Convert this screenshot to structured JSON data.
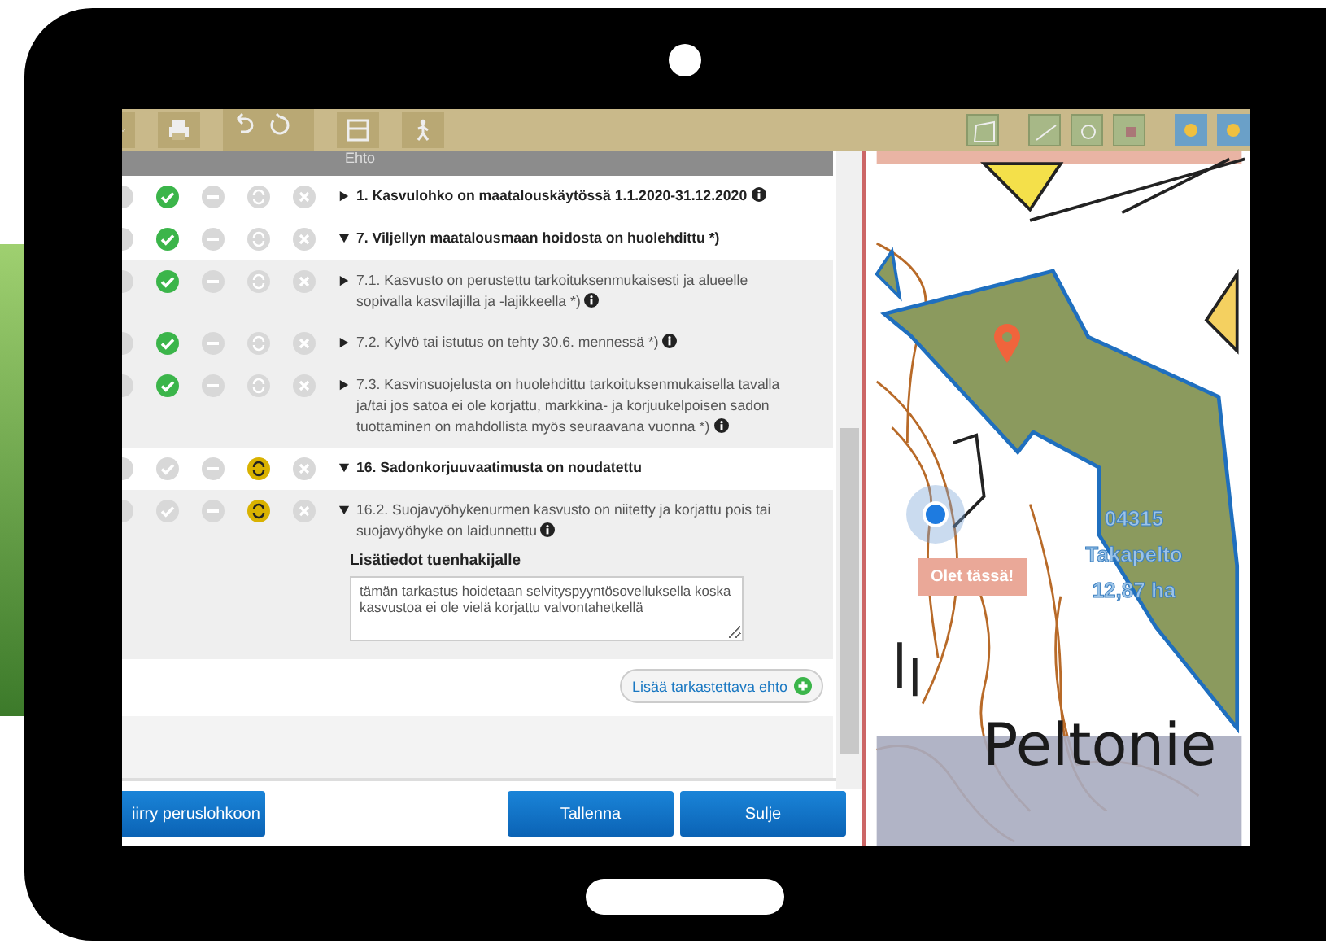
{
  "table": {
    "columns": [
      {
        "label": "Ehto"
      }
    ],
    "rows": [
      {
        "text": "1. Kasvulohko on maatalouskäytössä 1.1.2020-31.12.2020",
        "info": true,
        "expanded": false,
        "choices": [
          {
            "kind": "unknown",
            "selected": false
          },
          {
            "kind": "ok",
            "selected": true
          },
          {
            "kind": "na",
            "selected": false
          },
          {
            "kind": "pending",
            "selected": false
          },
          {
            "kind": "fail",
            "selected": false
          }
        ]
      },
      {
        "text": "7. Viljellyn maatalousmaan hoidosta on huolehdittu *)",
        "info": false,
        "expanded": true,
        "choices": [
          {
            "kind": "unknown",
            "selected": false
          },
          {
            "kind": "ok",
            "selected": true
          },
          {
            "kind": "na",
            "selected": false
          },
          {
            "kind": "pending",
            "selected": false
          },
          {
            "kind": "fail",
            "selected": false
          }
        ],
        "children": [
          {
            "text": "7.1. Kasvusto on perustettu tarkoituksenmukaisesti ja alueelle sopivalla kasvilajilla ja -lajikkeella *)",
            "info": true,
            "expanded": false,
            "choices": [
              {
                "kind": "unknown",
                "selected": false
              },
              {
                "kind": "ok",
                "selected": true
              },
              {
                "kind": "na",
                "selected": false
              },
              {
                "kind": "pending",
                "selected": false
              },
              {
                "kind": "fail",
                "selected": false
              }
            ]
          },
          {
            "text": "7.2. Kylvö tai istutus on tehty 30.6. mennessä *)",
            "info": true,
            "expanded": false,
            "choices": [
              {
                "kind": "unknown",
                "selected": false
              },
              {
                "kind": "ok",
                "selected": true
              },
              {
                "kind": "na",
                "selected": false
              },
              {
                "kind": "pending",
                "selected": false
              },
              {
                "kind": "fail",
                "selected": false
              }
            ]
          },
          {
            "text": "7.3. Kasvinsuojelusta on huolehdittu tarkoituksenmukaisella tavalla ja/tai jos satoa ei ole korjattu, markkina- ja korjuukelpoisen sadon tuottaminen on mahdollista myös seuraavana vuonna *)",
            "info": true,
            "expanded": false,
            "choices": [
              {
                "kind": "unknown",
                "selected": false
              },
              {
                "kind": "ok",
                "selected": true
              },
              {
                "kind": "na",
                "selected": false
              },
              {
                "kind": "pending",
                "selected": false
              },
              {
                "kind": "fail",
                "selected": false
              }
            ]
          }
        ]
      },
      {
        "text": "16. Sadonkorjuuvaatimusta on noudatettu",
        "info": false,
        "expanded": true,
        "choices": [
          {
            "kind": "unknown",
            "selected": false
          },
          {
            "kind": "ok",
            "selected": false
          },
          {
            "kind": "na",
            "selected": false
          },
          {
            "kind": "pending",
            "selected": true
          },
          {
            "kind": "fail",
            "selected": false
          }
        ],
        "children": [
          {
            "text": "16.2. Suojavyöhykenurmen kasvusto on niitetty ja korjattu pois tai suojavyöhyke on laidunnettu",
            "info": true,
            "expanded": true,
            "choices": [
              {
                "kind": "unknown",
                "selected": false
              },
              {
                "kind": "ok",
                "selected": false
              },
              {
                "kind": "na",
                "selected": false
              },
              {
                "kind": "pending",
                "selected": true
              },
              {
                "kind": "fail",
                "selected": false
              }
            ],
            "note": {
              "label": "Lisätiedot tuenhakijalle",
              "value": "tämän tarkastus hoidetaan selvityspyyntösovelluksella koska kasvustoa ei ole vielä korjattu valvontahetkellä"
            }
          }
        ]
      }
    ],
    "add_link": "Lisää tarkastettava ehto"
  },
  "footer": {
    "left_button": "iirry peruslohkoon",
    "right_buttons": [
      "Tallenna",
      "Sulje"
    ]
  },
  "map": {
    "location_label": "Olet tässä!",
    "parcel_labels": [
      "04315",
      "Takapelto",
      "12,87 ha"
    ],
    "place_name": "Peltonie"
  }
}
